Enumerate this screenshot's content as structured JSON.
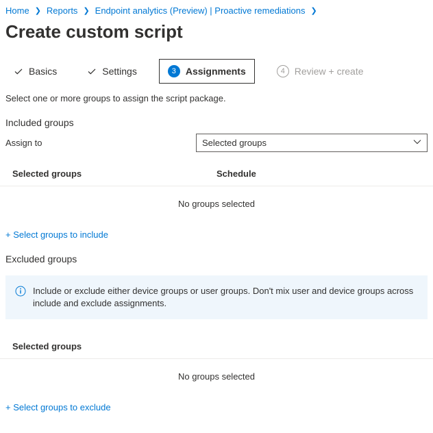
{
  "breadcrumb": {
    "items": [
      {
        "label": "Home"
      },
      {
        "label": "Reports"
      },
      {
        "label": "Endpoint analytics (Preview) | Proactive remediations"
      }
    ]
  },
  "page_title": "Create custom script",
  "tabs": {
    "basics": {
      "label": "Basics"
    },
    "settings": {
      "label": "Settings"
    },
    "assignments": {
      "num": "3",
      "label": "Assignments"
    },
    "review": {
      "num": "4",
      "label": "Review + create"
    }
  },
  "intro_text": "Select one or more groups to assign the script package.",
  "included": {
    "heading": "Included groups",
    "assign_label": "Assign to",
    "assign_value": "Selected groups",
    "col_groups": "Selected groups",
    "col_schedule": "Schedule",
    "empty": "No groups selected",
    "action": "+ Select groups to include"
  },
  "excluded": {
    "heading": "Excluded groups",
    "info": "Include or exclude either device groups or user groups. Don't mix user and device groups across include and exclude assignments.",
    "col_groups": "Selected groups",
    "empty": "No groups selected",
    "action": "+ Select groups to exclude"
  }
}
